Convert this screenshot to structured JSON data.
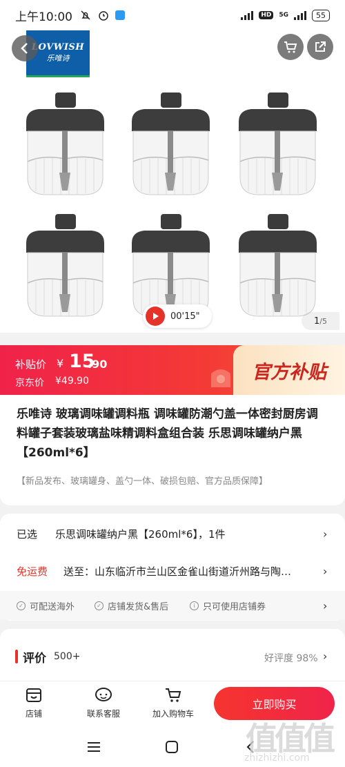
{
  "status_bar": {
    "time": "上午10:00",
    "network": "5G",
    "hd": "HD",
    "battery": "55"
  },
  "brand_logo": {
    "en": "LOVWISH",
    "cn": "乐唯诗"
  },
  "gallery": {
    "video_duration": "00'15\"",
    "page_current": "1",
    "page_total": "/5"
  },
  "price": {
    "subsidy_label": "补贴价",
    "currency": "¥",
    "subsidy_price_int": "15",
    "subsidy_price_dec": ".90",
    "jd_label": "京东价",
    "jd_price": "¥49.90",
    "official_label": "官方补贴"
  },
  "product": {
    "title": "乐唯诗 玻璃调味罐调料瓶 调味罐防潮勺盖一体密封厨房调料罐子套装玻璃盐味精调料盒组合装 乐思调味罐纳户黑【260ml*6】",
    "tags": "【新品发布、玻璃罐身、盖勺一体、破损包赔、官方品质保障】"
  },
  "spec": {
    "selected_label": "已选",
    "selected_value": "乐思调味罐纳户黑【260ml*6】，1件",
    "shipping_label": "免运费",
    "shipping_value": "送至：山东临沂市兰山区金雀山街道沂州路与陶…",
    "services": [
      "可配送海外",
      "店铺发货&售后",
      "只可使用店铺券"
    ]
  },
  "review": {
    "title": "评价",
    "count": "500+",
    "rate": "好评度 98%"
  },
  "actions": {
    "store": "店铺",
    "service": "联系客服",
    "cart": "加入购物车",
    "buy": "立即购买"
  },
  "watermark": {
    "big": "值值值",
    "small": "zhizhizhi.com"
  },
  "colors": {
    "accent": "#e5332a",
    "official_text": "#c8261e"
  }
}
